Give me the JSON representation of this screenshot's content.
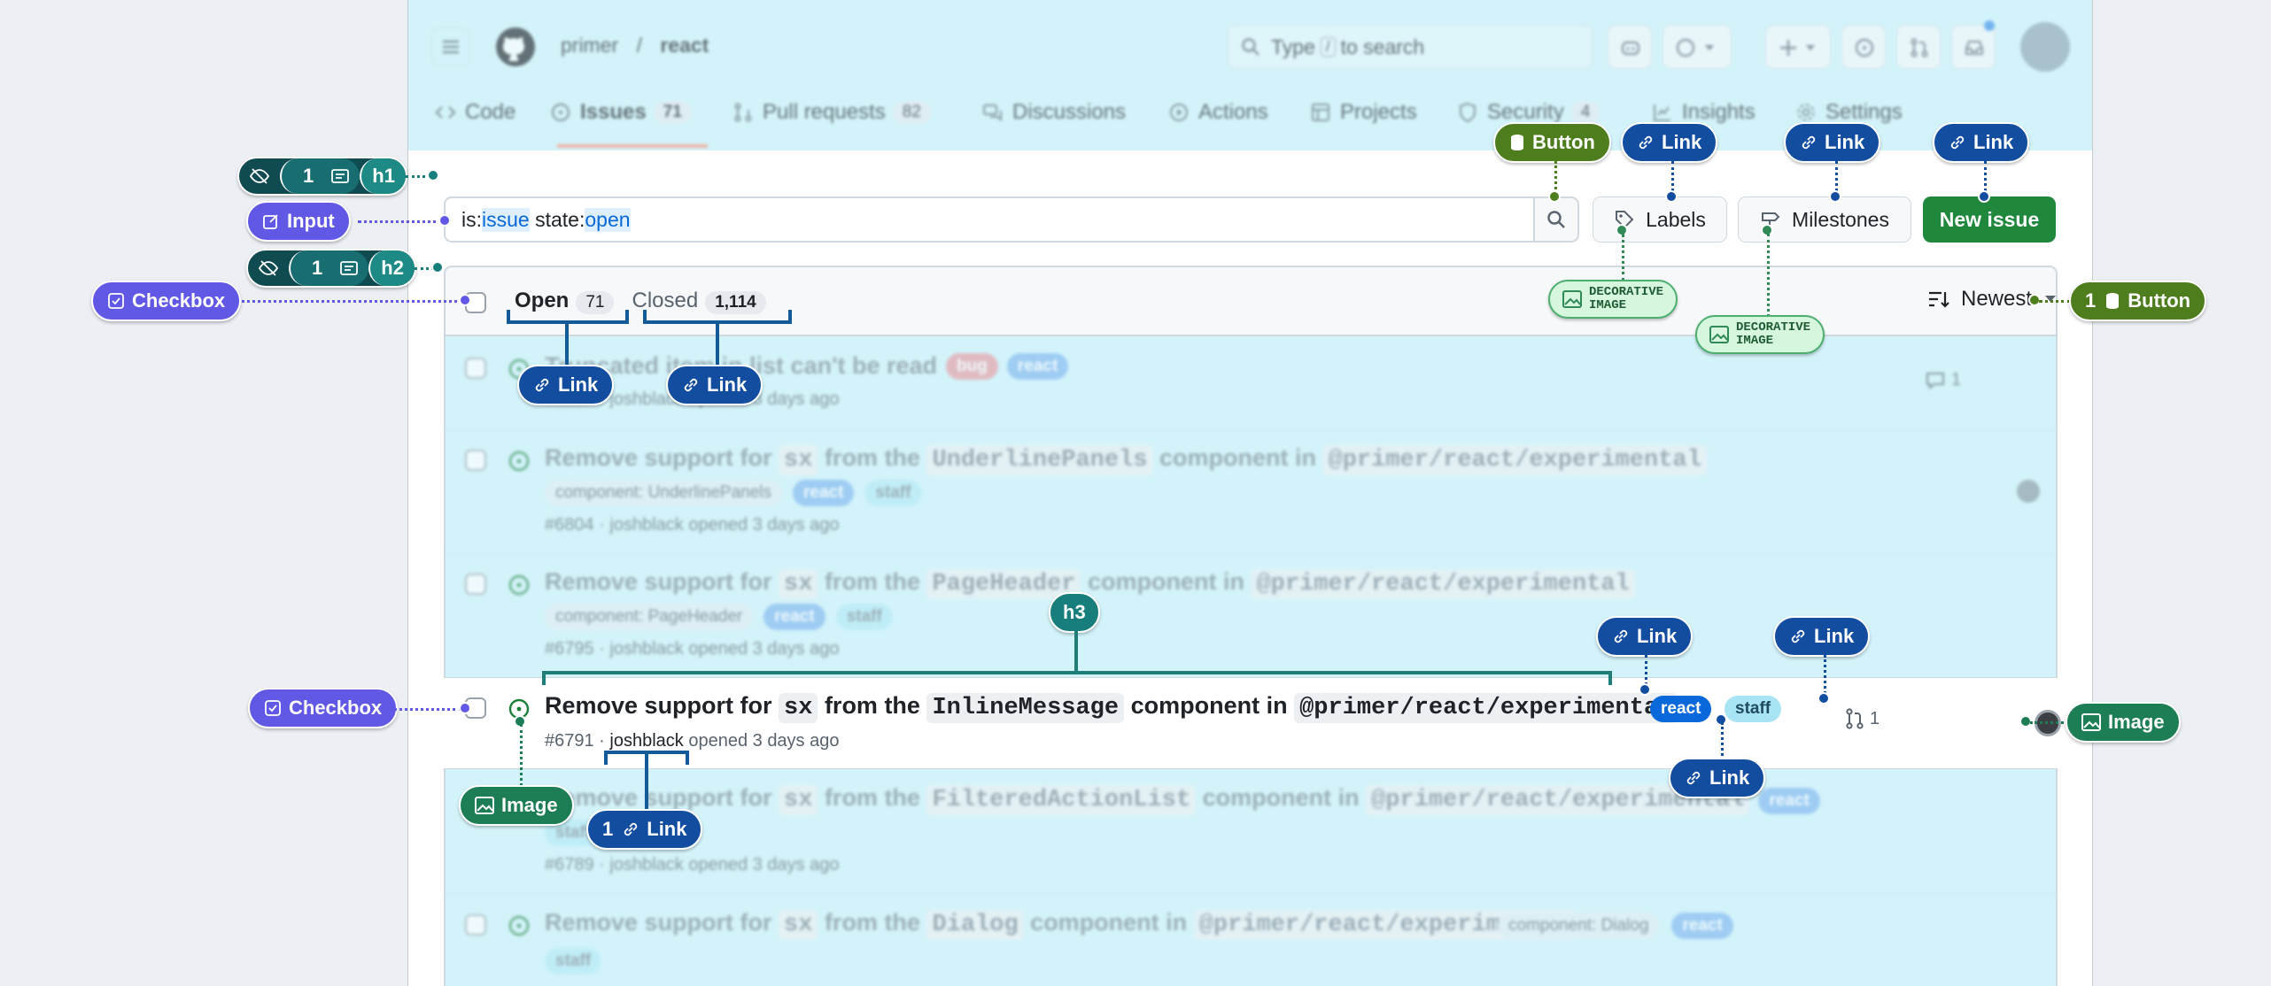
{
  "repo": {
    "owner": "primer",
    "separator": "/",
    "name": "react"
  },
  "search": {
    "placeholder_pre": "Type",
    "placeholder_key": "/",
    "placeholder_post": "to search"
  },
  "tabs": [
    {
      "label": "Code"
    },
    {
      "label": "Issues",
      "count": "71"
    },
    {
      "label": "Pull requests",
      "count": "82"
    },
    {
      "label": "Discussions"
    },
    {
      "label": "Actions"
    },
    {
      "label": "Projects"
    },
    {
      "label": "Security",
      "count": "4"
    },
    {
      "label": "Insights"
    },
    {
      "label": "Settings"
    }
  ],
  "filter": {
    "prefix": "is:",
    "key": "issue",
    "mid": " state:",
    "value": "open"
  },
  "buttons": {
    "labels": "Labels",
    "milestones": "Milestones",
    "new_issue": "New issue"
  },
  "list_header": {
    "open_label": "Open",
    "open_count": "71",
    "closed_label": "Closed",
    "closed_count": "1,114",
    "sort_label": "Newest"
  },
  "issues": [
    {
      "title": "Truncated item in list can't be read",
      "labels": [
        "bug",
        "react"
      ],
      "meta": "#6807 · joshblack opened 3 days ago",
      "comments": "1"
    },
    {
      "title_parts": [
        "Remove support for ",
        "sx",
        " from the ",
        "UnderlinePanels",
        " component in ",
        "@primer/react/experimental"
      ],
      "sub_labels": [
        "component: UnderlinePanels",
        "react",
        "staff"
      ],
      "meta": "#6804 · joshblack opened 3 days ago"
    },
    {
      "title_parts": [
        "Remove support for ",
        "sx",
        " from the ",
        "PageHeader",
        " component in ",
        "@primer/react/experimental"
      ],
      "sub_labels": [
        "component: PageHeader",
        "react",
        "staff"
      ],
      "meta": "#6795 · joshblack opened 3 days ago"
    },
    {
      "title_parts": [
        "Remove support for ",
        "sx",
        " from the ",
        "InlineMessage",
        " component in ",
        "@primer/react/experimental"
      ],
      "labels": [
        "react",
        "staff"
      ],
      "meta_num": "#6791 · ",
      "meta_author": "joshblack",
      "meta_rest": " opened 3 days ago",
      "linked_prs": "1"
    },
    {
      "title_parts": [
        "Remove support for ",
        "sx",
        " from the ",
        "FilteredActionList",
        " component in ",
        "@primer/react/experimental"
      ],
      "labels": [
        "react",
        "staff"
      ],
      "meta": "#6789 · joshblack opened 3 days ago"
    },
    {
      "title_parts": [
        "Remove support for ",
        "sx",
        " from the ",
        "Dialog",
        " component in ",
        "@primer/react/experimental"
      ],
      "labels": [
        "component: Dialog",
        "react",
        "staff"
      ]
    }
  ],
  "annotations": {
    "link": "Link",
    "button": "Button",
    "image": "Image",
    "input": "Input",
    "checkbox": "Checkbox",
    "decorative_line1": "DECORATIVE",
    "decorative_line2": "IMAGE",
    "h1": "h1",
    "h2": "h2",
    "h3": "h3",
    "count_one": "1"
  },
  "colors": {
    "overlay": "#d3f3fa",
    "link_tag": "#134da0",
    "button_tag": "#4e7d1e",
    "image_tag": "#1d7d55",
    "checkbox_tag": "#6158e6",
    "heading_tag": "#0f4b50",
    "new_issue": "#1f883d",
    "react_label": "#0969da",
    "staff_label": "#a8e4f3"
  }
}
